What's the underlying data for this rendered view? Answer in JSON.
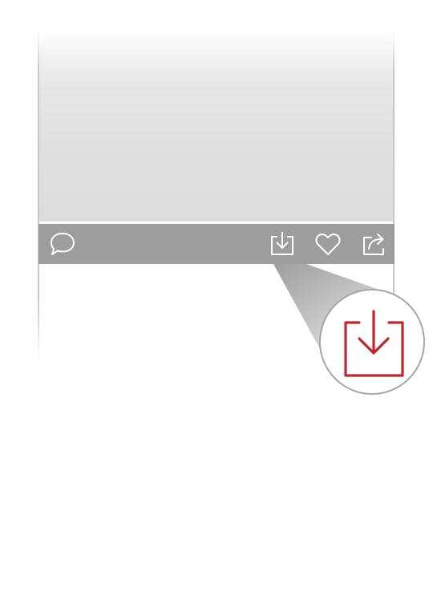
{
  "card": {
    "media": {
      "icon": "image-placeholder"
    },
    "toolbar": {
      "background": "#9d9d9d",
      "icon_color": "#ffffff",
      "actions": [
        {
          "id": "comment",
          "icon": "speech-bubble-icon"
        },
        {
          "id": "download",
          "icon": "download-tray-icon"
        },
        {
          "id": "like",
          "icon": "heart-icon"
        },
        {
          "id": "share",
          "icon": "share-arrow-icon"
        }
      ]
    }
  },
  "callout": {
    "highlighted_action": "download",
    "icon": "download-tray-icon",
    "icon_color": "#c0272d",
    "border_color": "#a6a6a6"
  }
}
